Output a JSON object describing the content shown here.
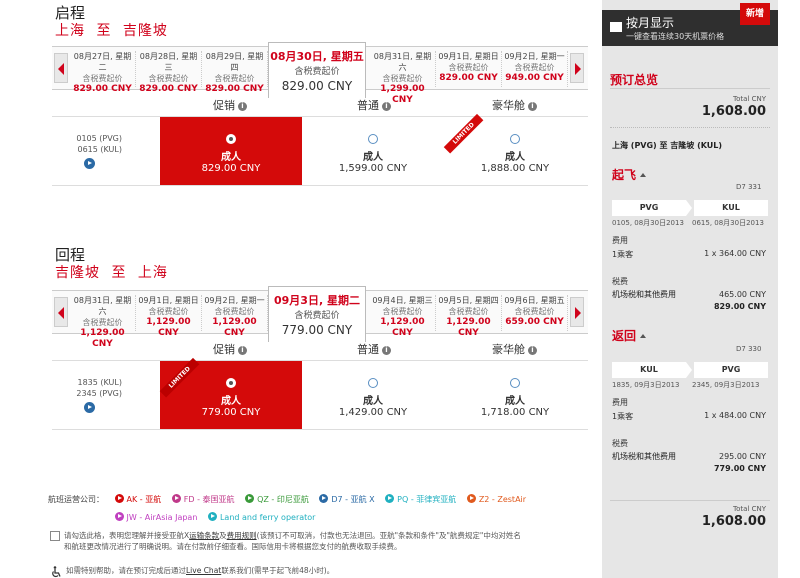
{
  "outbound": {
    "title": "启程",
    "from": "上海",
    "to_word": "至",
    "to": "吉隆坡",
    "dates": [
      {
        "date": "08月27日, 星期二",
        "sub": "含税费起价",
        "price": "829.00 CNY"
      },
      {
        "date": "08月28日, 星期三",
        "sub": "含税费起价",
        "price": "829.00 CNY"
      },
      {
        "date": "08月29日, 星期四",
        "sub": "含税费起价",
        "price": "829.00 CNY"
      },
      {
        "date": "08月31日, 星期六",
        "sub": "含税费起价",
        "price": "1,299.00 CNY"
      },
      {
        "date": "09月1日, 星期日",
        "sub": "含税费起价",
        "price": "829.00 CNY"
      },
      {
        "date": "09月2日, 星期一",
        "sub": "含税费起价",
        "price": "949.00 CNY"
      }
    ],
    "selected": {
      "date": "08月30日, 星期五",
      "sub": "含税费起价",
      "price": "829.00 CNY"
    },
    "col_promo": "促销",
    "col_regular": "普通",
    "col_premium": "豪华舱",
    "dep_time": "0105 (PVG)",
    "arr_time": "0615 (KUL)",
    "fares": [
      {
        "label": "成人",
        "price": "829.00 CNY"
      },
      {
        "label": "成人",
        "price": "1,599.00 CNY"
      },
      {
        "label": "成人",
        "price": "1,888.00 CNY"
      }
    ],
    "ribbon": "LIMITED"
  },
  "return": {
    "title": "回程",
    "from": "吉隆坡",
    "to_word": "至",
    "to": "上海",
    "dates": [
      {
        "date": "08月31日, 星期六",
        "sub": "含税费起价",
        "price": "1,129.00 CNY"
      },
      {
        "date": "09月1日, 星期日",
        "sub": "含税费起价",
        "price": "1,129.00 CNY"
      },
      {
        "date": "09月2日, 星期一",
        "sub": "含税费起价",
        "price": "1,129.00 CNY"
      },
      {
        "date": "09月4日, 星期三",
        "sub": "含税费起价",
        "price": "1,129.00 CNY"
      },
      {
        "date": "09月5日, 星期四",
        "sub": "含税费起价",
        "price": "1,129.00 CNY"
      },
      {
        "date": "09月6日, 星期五",
        "sub": "含税费起价",
        "price": "659.00 CNY"
      }
    ],
    "selected": {
      "date": "09月3日, 星期二",
      "sub": "含税费起价",
      "price": "779.00 CNY"
    },
    "col_promo": "促销",
    "col_regular": "普通",
    "col_premium": "豪华舱",
    "dep_time": "1835 (KUL)",
    "arr_time": "2345 (PVG)",
    "fares": [
      {
        "label": "成人",
        "price": "779.00 CNY"
      },
      {
        "label": "成人",
        "price": "1,429.00 CNY"
      },
      {
        "label": "成人",
        "price": "1,718.00 CNY"
      }
    ],
    "ribbon": "LIMITED"
  },
  "info_glyph": "i",
  "airlines": {
    "label": "航班运营公司：",
    "items": [
      {
        "text": "AK - 亚航",
        "color": "#d40a0a"
      },
      {
        "text": "FD - 泰国亚航",
        "color": "#c0398a"
      },
      {
        "text": "QZ - 印尼亚航",
        "color": "#3a9a3a"
      },
      {
        "text": "D7 - 亚航 X",
        "color": "#2b6aa5"
      },
      {
        "text": "PQ - 菲律宾亚航",
        "color": "#20b0c0"
      },
      {
        "text": "Z2 - ZestAir",
        "color": "#e05a1e"
      },
      {
        "text": "JW - AirAsia Japan",
        "color": "#c040c0"
      },
      {
        "text": "Land and ferry operator",
        "color": "#20b0c0"
      }
    ]
  },
  "terms": {
    "line1_a": "请勾选此格，表明您理解并接受亚航X",
    "link1": "运输条款",
    "line1_b": "及",
    "link2": "费用规则",
    "line1_c": "(该预订不可取消，付款也无法退回。亚航\"条款和条件\"及\"航费规定\"中均对姓名",
    "line2": "和航班更改情况进行了明确说明。请在付款前仔细查看。国际信用卡将根据您支付的航费收取手续费。"
  },
  "help": {
    "a": "如需特别帮助，请在预订完成后通过",
    "link": "Live Chat",
    "b": "联系我们(需早于起飞前48小时)。"
  },
  "sidebar": {
    "toggle_title": "按月显示",
    "toggle_sub": "一键查看连续30天机票价格",
    "new_badge": "新增",
    "summary_title": "预订总览",
    "total_label": "Total CNY",
    "total": "1,608.00",
    "route": "上海 (PVG) 至 吉隆坡 (KUL)",
    "depart": {
      "title": "起飞",
      "flight": "D7 331",
      "from": "PVG",
      "to": "KUL",
      "from_time": "0105, 08月30日2013",
      "to_time": "0615, 08月30日2013",
      "fare_label": "费用",
      "pax": "1乘客",
      "pax_fare": "1 x 364.00 CNY",
      "tax_label": "税费",
      "tax_desc": "机场税和其他费用",
      "tax": "465.00 CNY",
      "subtotal": "829.00 CNY"
    },
    "return": {
      "title": "返回",
      "flight": "D7 330",
      "from": "KUL",
      "to": "PVG",
      "from_time": "1835, 09月3日2013",
      "to_time": "2345, 09月3日2013",
      "fare_label": "费用",
      "pax": "1乘客",
      "pax_fare": "1 x 484.00 CNY",
      "tax_label": "税费",
      "tax_desc": "机场税和其他费用",
      "tax": "295.00 CNY",
      "subtotal": "779.00 CNY"
    },
    "bottom_total_label": "Total CNY",
    "bottom_total": "1,608.00"
  }
}
